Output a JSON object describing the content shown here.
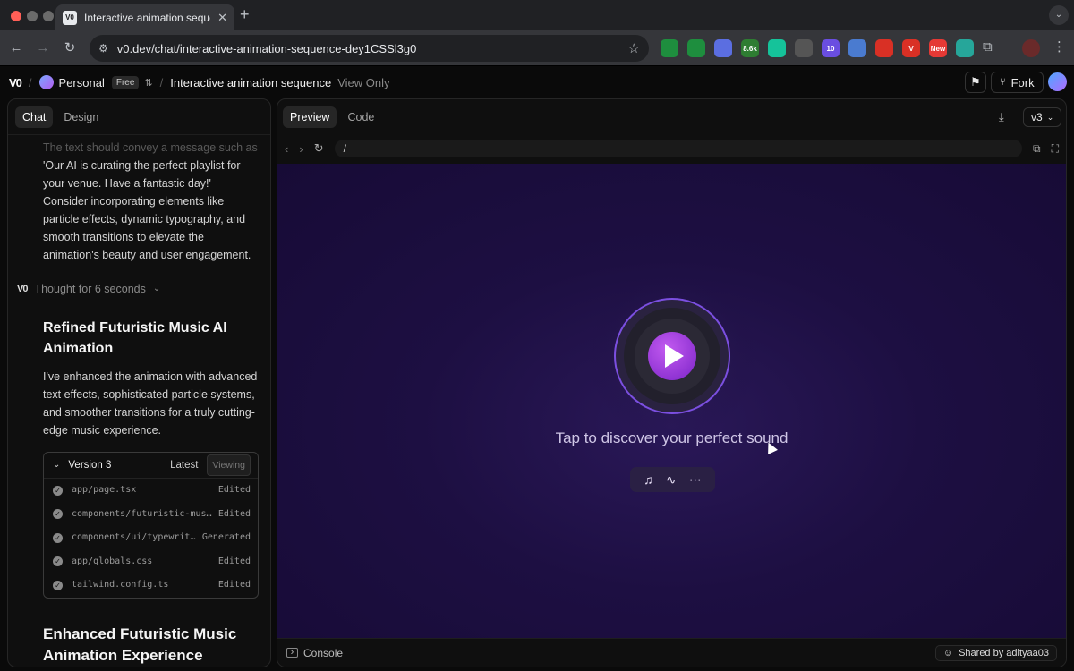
{
  "browser": {
    "tab_title": "Interactive animation sequence",
    "url": "v0.dev/chat/interactive-animation-sequence-dey1CSSl3g0",
    "extensions": [
      {
        "name": "ext-green",
        "color": "#1e8e3e",
        "label": ""
      },
      {
        "name": "ext-cursor",
        "color": "#1e8e3e",
        "label": ""
      },
      {
        "name": "ext-blue",
        "color": "#5b6ee1",
        "label": ""
      },
      {
        "name": "ext-counter",
        "color": "#2e7d32",
        "label": "8.6k"
      },
      {
        "name": "ext-grammarly",
        "color": "#15c39a",
        "label": ""
      },
      {
        "name": "ext-pen",
        "color": "#555",
        "label": ""
      },
      {
        "name": "ext-badge",
        "color": "#6a4ee1",
        "label": "10"
      },
      {
        "name": "ext-screen",
        "color": "#4a7bd0",
        "label": ""
      },
      {
        "name": "ext-red",
        "color": "#d93025",
        "label": ""
      },
      {
        "name": "ext-v",
        "color": "#d93025",
        "label": "V"
      },
      {
        "name": "ext-new",
        "color": "#e53935",
        "label": "New"
      },
      {
        "name": "ext-teal",
        "color": "#26a69a",
        "label": ""
      }
    ]
  },
  "header": {
    "logo": "V0",
    "workspace": "Personal",
    "plan_badge": "Free",
    "project_title": "Interactive animation sequence",
    "mode": "View Only",
    "fork_label": "Fork"
  },
  "left": {
    "tabs": [
      "Chat",
      "Design"
    ],
    "faded_line": "The text should convey a message such as",
    "prompt_text": "'Our AI is curating the perfect playlist for your venue. Have a fantastic day!' Consider incorporating elements like particle effects, dynamic typography, and smooth transitions to elevate the animation's beauty and user engagement.",
    "thought": "Thought for 6 seconds",
    "heading1": "Refined Futuristic Music AI Animation",
    "body1": "I've enhanced the animation with advanced text effects, sophisticated particle systems, and smoother transitions for a truly cutting-edge music experience.",
    "version": {
      "label": "Version 3",
      "latest": "Latest",
      "viewing": "Viewing",
      "files": [
        {
          "name": "app/page.tsx",
          "status": "Edited"
        },
        {
          "name": "components/futuristic-music-…",
          "status": "Edited"
        },
        {
          "name": "components/ui/typewriter…",
          "status": "Generated"
        },
        {
          "name": "app/globals.css",
          "status": "Edited"
        },
        {
          "name": "tailwind.config.ts",
          "status": "Edited"
        }
      ]
    },
    "heading2": "Enhanced Futuristic Music Animation Experience"
  },
  "right": {
    "tabs": [
      "Preview",
      "Code"
    ],
    "version_select": "v3",
    "path": "/",
    "tagline": "Tap to discover your perfect sound",
    "console_label": "Console",
    "shared_by": "Shared by adityaa03"
  },
  "colors": {
    "accent_purple": "#a63ee0",
    "ring": "#7b4fe0"
  }
}
